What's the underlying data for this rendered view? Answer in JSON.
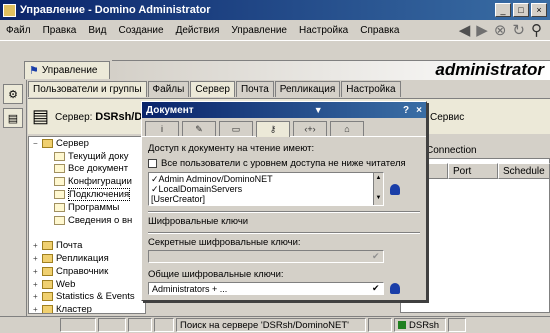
{
  "window": {
    "title": "Управление - Domino Administrator"
  },
  "window_controls": [
    "_",
    "□",
    "×"
  ],
  "menu": [
    "Файл",
    "Правка",
    "Вид",
    "Создание",
    "Действия",
    "Управление",
    "Настройка",
    "Справка"
  ],
  "view_tab": "Управление",
  "app_title": "administrator",
  "admin_tabs": [
    "Пользователи и группы",
    "Файлы",
    "Сервер",
    "Почта",
    "Репликация",
    "Настройка"
  ],
  "server": {
    "label": "Сервер:",
    "name": "DSRsh/D"
  },
  "service_label": "Сервис",
  "tree": [
    {
      "label": "Сервер",
      "level": 0,
      "exp": "−",
      "kind": "folder"
    },
    {
      "label": "Текущий доку",
      "level": 1,
      "kind": "doc"
    },
    {
      "label": "Все документ",
      "level": 1,
      "kind": "doc"
    },
    {
      "label": "Конфигурации",
      "level": 1,
      "kind": "doc"
    },
    {
      "label": "Подключения",
      "level": 1,
      "kind": "doc",
      "selected": true
    },
    {
      "label": "Программы",
      "level": 1,
      "kind": "doc"
    },
    {
      "label": "Сведения о вн",
      "level": 1,
      "kind": "doc"
    },
    {
      "label": "",
      "level": 1,
      "kind": "none"
    },
    {
      "label": "Почта",
      "level": 0,
      "exp": "+",
      "kind": "folder"
    },
    {
      "label": "Репликация",
      "level": 0,
      "exp": "+",
      "kind": "folder"
    },
    {
      "label": "Справочник",
      "level": 0,
      "exp": "+",
      "kind": "folder"
    },
    {
      "label": "Web",
      "level": 0,
      "exp": "+",
      "kind": "folder"
    },
    {
      "label": "Statistics & Events",
      "level": 0,
      "exp": "+",
      "kind": "folder"
    },
    {
      "label": "Кластер",
      "level": 0,
      "exp": "+",
      "kind": "folder"
    }
  ],
  "right_header": "Connection",
  "columns": [
    "Port",
    "Schedule"
  ],
  "dialog": {
    "title": "Документ",
    "controls": [
      "?",
      "×"
    ],
    "tab_icons": [
      "i",
      "✎",
      "▭",
      "⚷",
      "‹+›",
      "⌂"
    ],
    "access_label": "Доступ к документу на чтение имеют:",
    "all_users_label": "Все пользователи с уровнем доступа не ниже читателя",
    "access_list": [
      "✓Admin Adminov/DominoNET",
      "✓LocalDomainServers",
      "[UserCreator]"
    ],
    "enc_section": "Шифровальные ключи",
    "secret_label": "Секретные шифровальные ключи:",
    "secret_value": "",
    "public_label": "Общие шифровальные ключи:",
    "public_value": "Administrators + ..."
  },
  "status": {
    "search": "Поиск на сервере 'DSRsh/DominoNET'",
    "server": "DSRsh"
  }
}
